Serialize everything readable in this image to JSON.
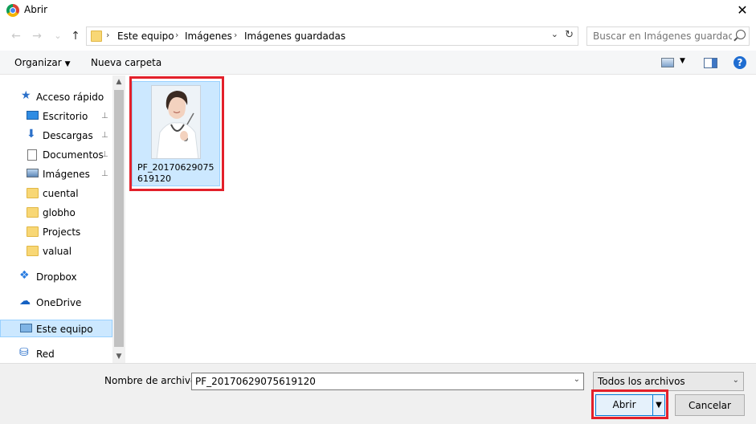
{
  "window": {
    "title": "Abrir",
    "close_glyph": "✕"
  },
  "nav": {
    "back_glyph": "←",
    "forward_glyph": "→",
    "recent_glyph": "⌄",
    "up_glyph": "↑"
  },
  "address": {
    "separator": "›",
    "crumbs": [
      "Este equipo",
      "Imágenes",
      "Imágenes guardadas"
    ],
    "dropdown_glyph": "⌄",
    "refresh_glyph": "↻"
  },
  "search": {
    "placeholder": "Buscar en Imágenes guardadas"
  },
  "toolbar": {
    "organize_label": "Organizar",
    "organize_caret": "▼",
    "new_folder_label": "Nueva carpeta",
    "view_caret": "▼",
    "help_glyph": "?"
  },
  "sidebar": {
    "items": [
      {
        "label": "Acceso rápido",
        "icon": "star-icon"
      },
      {
        "label": "Escritorio",
        "icon": "desktop-icon",
        "pinned": true
      },
      {
        "label": "Descargas",
        "icon": "download-icon",
        "pinned": true
      },
      {
        "label": "Documentos",
        "icon": "documents-icon",
        "pinned": true
      },
      {
        "label": "Imágenes",
        "icon": "pictures-icon",
        "pinned": true
      },
      {
        "label": "cuental",
        "icon": "folder-icon"
      },
      {
        "label": "globho",
        "icon": "folder-icon"
      },
      {
        "label": "Projects",
        "icon": "folder-icon"
      },
      {
        "label": "valual",
        "icon": "folder-icon"
      },
      {
        "label": "Dropbox",
        "icon": "dropbox-icon"
      },
      {
        "label": "OneDrive",
        "icon": "onedrive-icon"
      },
      {
        "label": "Este equipo",
        "icon": "computer-icon",
        "selected": true
      },
      {
        "label": "Red",
        "icon": "network-icon"
      }
    ],
    "pin_glyph": "📌"
  },
  "scroll": {
    "up_glyph": "▲",
    "down_glyph": "▼"
  },
  "files": [
    {
      "name": "PF_20170629075619120",
      "selected": true
    }
  ],
  "footer": {
    "filename_label": "Nombre de archivo:",
    "filename_value": "PF_20170629075619120",
    "dropdown_glyph": "⌄",
    "filetype_value": "Todos los archivos",
    "open_label": "Abrir",
    "split_glyph": "▼",
    "cancel_label": "Cancelar"
  },
  "colors": {
    "selection": "#cce8ff",
    "selection_border": "#99d1ff",
    "highlight": "#e3202a",
    "accent": "#0078d7"
  }
}
